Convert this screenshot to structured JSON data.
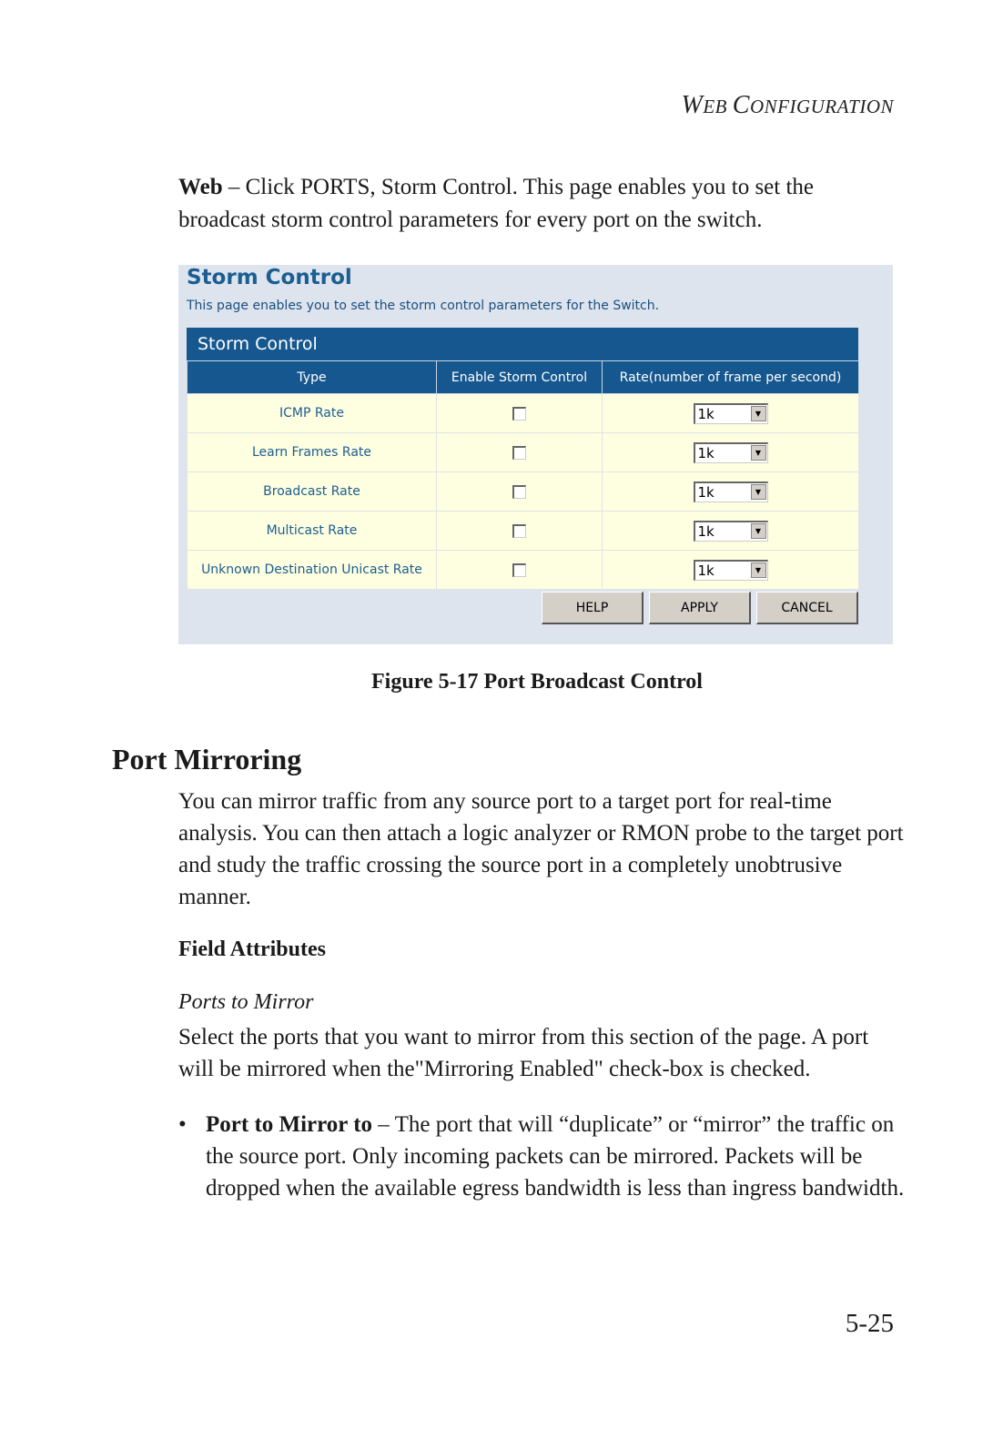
{
  "running_head": {
    "first": "W",
    "first_rest": "EB ",
    "second": "C",
    "second_rest": "ONFIGURATION"
  },
  "intro": {
    "bold": "Web",
    "text": " – Click PORTS, Storm Control. This page enables you to set the broadcast storm control parameters for every port on the switch."
  },
  "screenshot": {
    "title": "Storm Control",
    "description": "This page enables you to set the storm control parameters for the Switch.",
    "panel_title": "Storm Control",
    "columns": [
      "Type",
      "Enable Storm Control",
      "Rate(number of frame per second)"
    ],
    "rows": [
      {
        "type": "ICMP Rate",
        "enabled": false,
        "rate": "1k"
      },
      {
        "type": "Learn Frames Rate",
        "enabled": false,
        "rate": "1k"
      },
      {
        "type": "Broadcast Rate",
        "enabled": false,
        "rate": "1k"
      },
      {
        "type": "Multicast Rate",
        "enabled": false,
        "rate": "1k"
      },
      {
        "type": "Unknown Destination Unicast Rate",
        "enabled": false,
        "rate": "1k"
      }
    ],
    "buttons": {
      "help": "HELP",
      "apply": "APPLY",
      "cancel": "CANCEL"
    },
    "dropdown_icon": "▼"
  },
  "caption": "Figure 5-17  Port Broadcast Control",
  "section_title": "Port Mirroring",
  "section_body": "You can mirror traffic from any source port to a target port for real-time analysis. You can then attach a logic analyzer or RMON probe to the target port and study the traffic crossing the source port in a completely unobtrusive manner.",
  "field_attributes": "Field Attributes",
  "ports_to_mirror": "Ports to Mirror",
  "ports_body": "Select the ports that you want to mirror from this section of the page. A port will be mirrored when the\"Mirroring Enabled\" check-box is checked.",
  "bullet": {
    "symbol": "•",
    "bold": "Port to Mirror to",
    "text": " – The port that will “duplicate” or “mirror” the traffic on the source port. Only incoming packets can be mirrored. Packets will be dropped when the available egress bandwidth is less than ingress bandwidth."
  },
  "page_number": "5-25"
}
